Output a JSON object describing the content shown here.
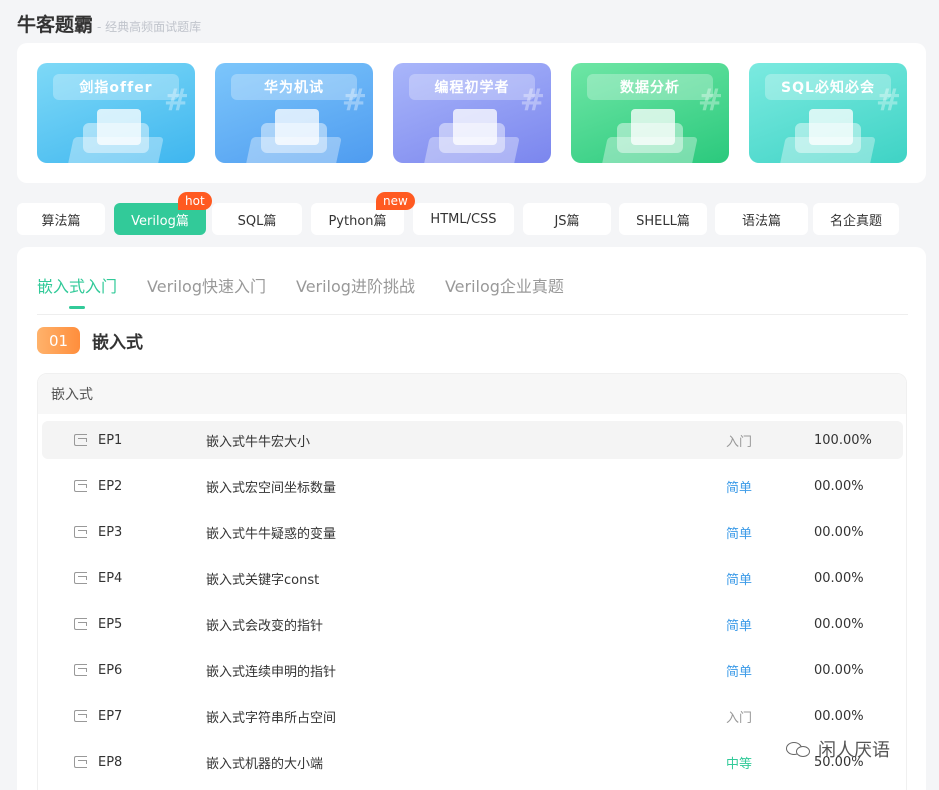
{
  "header": {
    "brand": "牛客题霸",
    "tagline": "- 经典高频面试题库"
  },
  "banners": [
    {
      "label": "剑指offer",
      "icon": "book-stack-icon",
      "colors": [
        "#7ed9f7",
        "#3fb6ef"
      ]
    },
    {
      "label": "华为机试",
      "icon": "laptop-icon",
      "colors": [
        "#7cc6fb",
        "#4f9cf0"
      ]
    },
    {
      "label": "编程初学者",
      "icon": "code-brackets-icon",
      "colors": [
        "#a9b6fa",
        "#7b86ee"
      ]
    },
    {
      "label": "数据分析",
      "icon": "pie-chart-icon",
      "colors": [
        "#6ee6a5",
        "#2bc97d"
      ]
    },
    {
      "label": "SQL必知必会",
      "icon": "book-stack-icon",
      "colors": [
        "#7beae0",
        "#3fd3c5"
      ]
    }
  ],
  "lang_tabs": [
    {
      "label": "算法篇",
      "active": false,
      "badge": ""
    },
    {
      "label": "Verilog篇",
      "active": true,
      "badge": "hot"
    },
    {
      "label": "SQL篇",
      "active": false,
      "badge": ""
    },
    {
      "label": "Python篇",
      "active": false,
      "badge": "new"
    },
    {
      "label": "HTML/CSS",
      "active": false,
      "badge": ""
    },
    {
      "label": "JS篇",
      "active": false,
      "badge": ""
    },
    {
      "label": "SHELL篇",
      "active": false,
      "badge": ""
    },
    {
      "label": "语法篇",
      "active": false,
      "badge": ""
    },
    {
      "label": "名企真题",
      "active": false,
      "badge": ""
    }
  ],
  "sub_tabs": [
    {
      "label": "嵌入式入门",
      "active": true
    },
    {
      "label": "Verilog快速入门",
      "active": false
    },
    {
      "label": "Verilog进阶挑战",
      "active": false
    },
    {
      "label": "Verilog企业真题",
      "active": false
    }
  ],
  "section": {
    "number": "01",
    "title": "嵌入式"
  },
  "list": {
    "header": "嵌入式",
    "rows": [
      {
        "code": "EP1",
        "title": "嵌入式牛牛宏大小",
        "difficulty": "入门",
        "rate": "100.00%",
        "highlighted": true
      },
      {
        "code": "EP2",
        "title": "嵌入式宏空间坐标数量",
        "difficulty": "简单",
        "rate": "00.00%",
        "highlighted": false
      },
      {
        "code": "EP3",
        "title": "嵌入式牛牛疑惑的变量",
        "difficulty": "简单",
        "rate": "00.00%",
        "highlighted": false
      },
      {
        "code": "EP4",
        "title": "嵌入式关键字const",
        "difficulty": "简单",
        "rate": "00.00%",
        "highlighted": false
      },
      {
        "code": "EP5",
        "title": "嵌入式会改变的指针",
        "difficulty": "简单",
        "rate": "00.00%",
        "highlighted": false
      },
      {
        "code": "EP6",
        "title": "嵌入式连续申明的指针",
        "difficulty": "简单",
        "rate": "00.00%",
        "highlighted": false
      },
      {
        "code": "EP7",
        "title": "嵌入式字符串所占空间",
        "difficulty": "入门",
        "rate": "00.00%",
        "highlighted": false
      },
      {
        "code": "EP8",
        "title": "嵌入式机器的大小端",
        "difficulty": "中等",
        "rate": "50.00%",
        "highlighted": false
      }
    ]
  },
  "difficulty_colors": {
    "入门": "#999999",
    "简单": "#3c9be8",
    "中等": "#32ca99"
  },
  "watermark": {
    "text": "闲人厌语",
    "icon": "wechat-icon"
  }
}
